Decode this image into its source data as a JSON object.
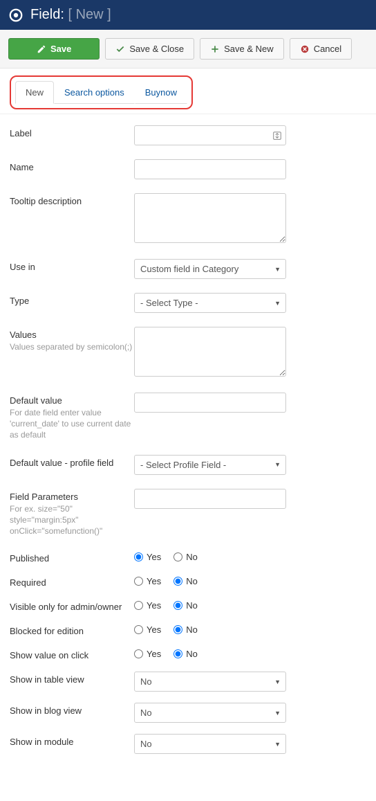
{
  "header": {
    "title_prefix": "Field:",
    "title_new": "[ New ]"
  },
  "toolbar": {
    "save": "Save",
    "save_close": "Save & Close",
    "save_new": "Save & New",
    "cancel": "Cancel"
  },
  "tabs": {
    "new": "New",
    "search_options": "Search options",
    "buynow": "Buynow"
  },
  "labels": {
    "label": "Label",
    "name": "Name",
    "tooltip": "Tooltip description",
    "use_in": "Use in",
    "type": "Type",
    "values": "Values",
    "values_hint": "Values separated by semicolon(;)",
    "default_value": "Default value",
    "default_value_hint": "For date field enter value 'current_date' to use current date as default",
    "default_profile": "Default value - profile field",
    "field_params": "Field Parameters",
    "field_params_hint": "For ex. size=\"50\" style=\"margin:5px\" onClick=\"somefunction()\"",
    "published": "Published",
    "required": "Required",
    "visible_admin": "Visible only for admin/owner",
    "blocked_edit": "Blocked for edition",
    "show_on_click": "Show value on click",
    "show_table": "Show in table view",
    "show_blog": "Show in blog view",
    "show_module": "Show in module"
  },
  "options": {
    "use_in_selected": "Custom field in Category",
    "type_selected": "- Select Type -",
    "profile_selected": "- Select Profile Field -",
    "no": "No",
    "yes": "Yes"
  },
  "radio": {
    "yes": "Yes",
    "no": "No"
  },
  "values": {
    "published": "yes",
    "required": "no",
    "visible_admin": "no",
    "blocked_edit": "no",
    "show_on_click": "no"
  }
}
